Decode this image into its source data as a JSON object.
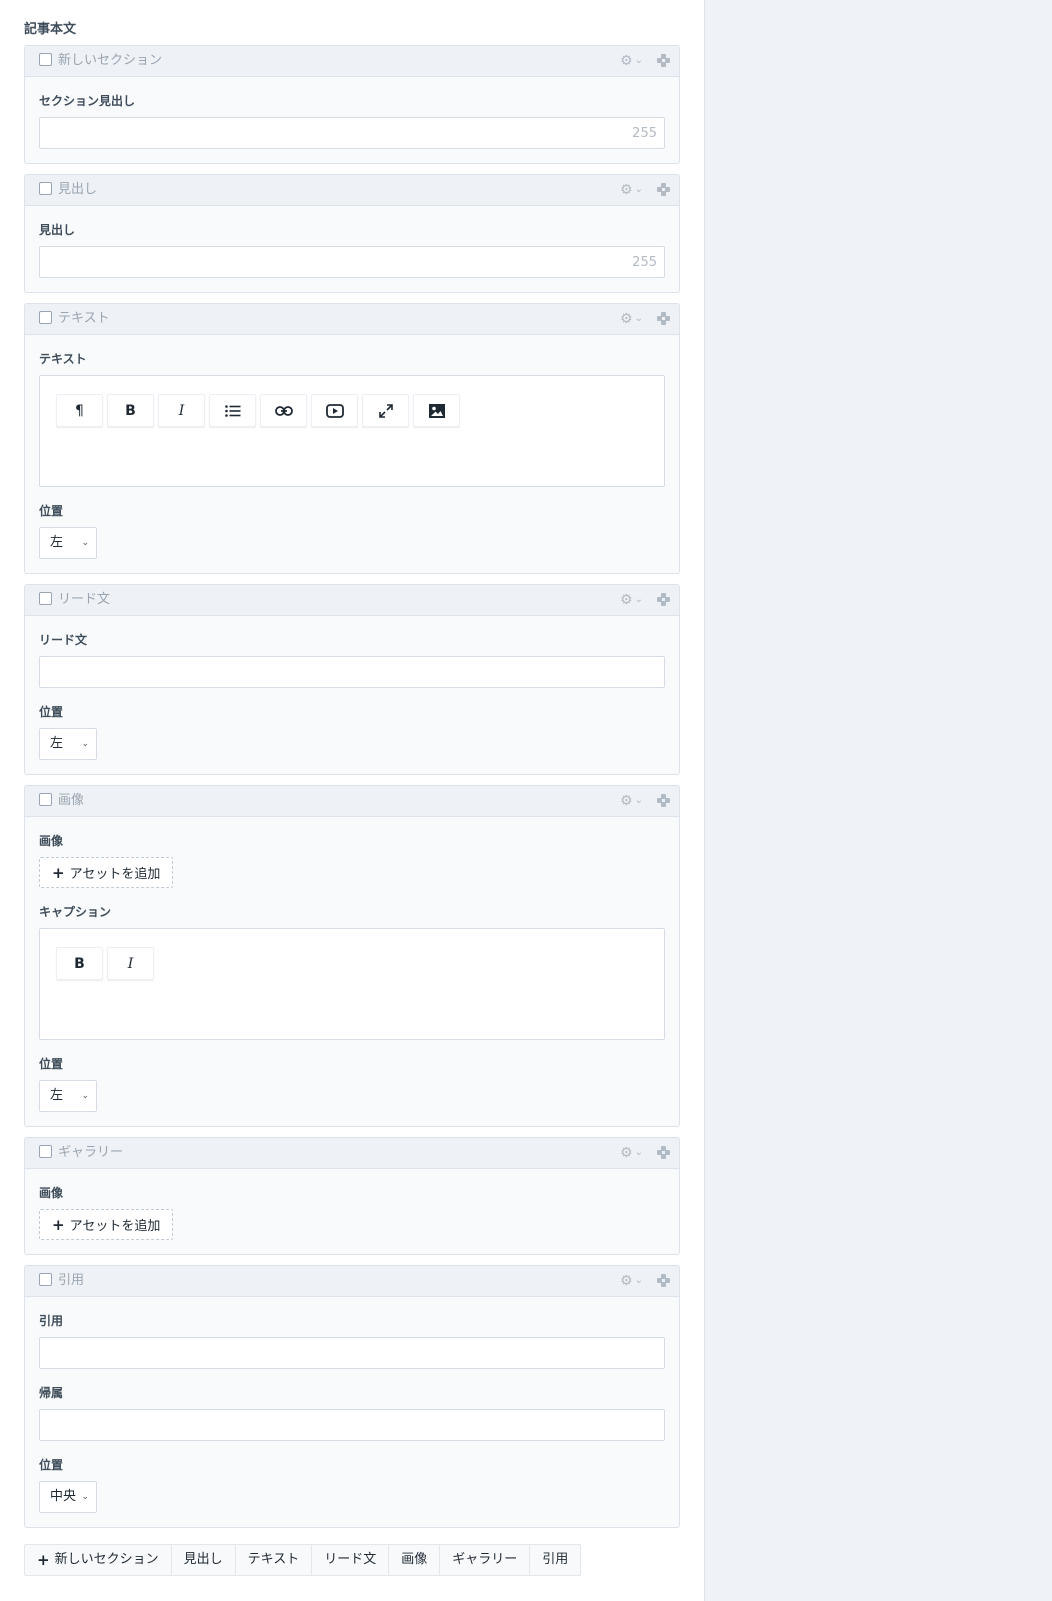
{
  "field": {
    "title": "記事本文"
  },
  "blocks": {
    "new_section": {
      "name": "新しいセクション",
      "label": "セクション見出し",
      "counter": "255"
    },
    "heading": {
      "name": "見出し",
      "label": "見出し",
      "counter": "255"
    },
    "text": {
      "name": "テキスト",
      "label": "テキスト",
      "position_label": "位置",
      "position_value": "左"
    },
    "lead": {
      "name": "リード文",
      "label": "リード文",
      "position_label": "位置",
      "position_value": "左"
    },
    "image": {
      "name": "画像",
      "label": "画像",
      "add_asset": "アセットを追加",
      "caption_label": "キャプション",
      "position_label": "位置",
      "position_value": "左"
    },
    "gallery": {
      "name": "ギャラリー",
      "label": "画像",
      "add_asset": "アセットを追加"
    },
    "quote": {
      "name": "引用",
      "label": "引用",
      "attribution_label": "帰属",
      "position_label": "位置",
      "position_value": "中央"
    }
  },
  "toolbar": {
    "paragraph": "¶",
    "bold": "B",
    "italic": "I"
  },
  "add_buttons": {
    "new_section": "新しいセクション",
    "heading": "見出し",
    "text": "テキスト",
    "lead": "リード文",
    "image": "画像",
    "gallery": "ギャラリー",
    "quote": "引用"
  },
  "icons": {
    "gear": "gear-icon",
    "chevron": "chevron-down-icon",
    "move": "move-icon",
    "list": "list-icon",
    "link": "link-icon",
    "video": "video-icon",
    "fullscreen": "expand-icon",
    "image": "image-icon",
    "plus": "plus-icon"
  },
  "colors": {
    "panel_bg": "#eff3f7",
    "block_header_bg": "#eef1f5",
    "block_body_bg": "#f9fafc",
    "muted_text": "#9aa5b1"
  }
}
